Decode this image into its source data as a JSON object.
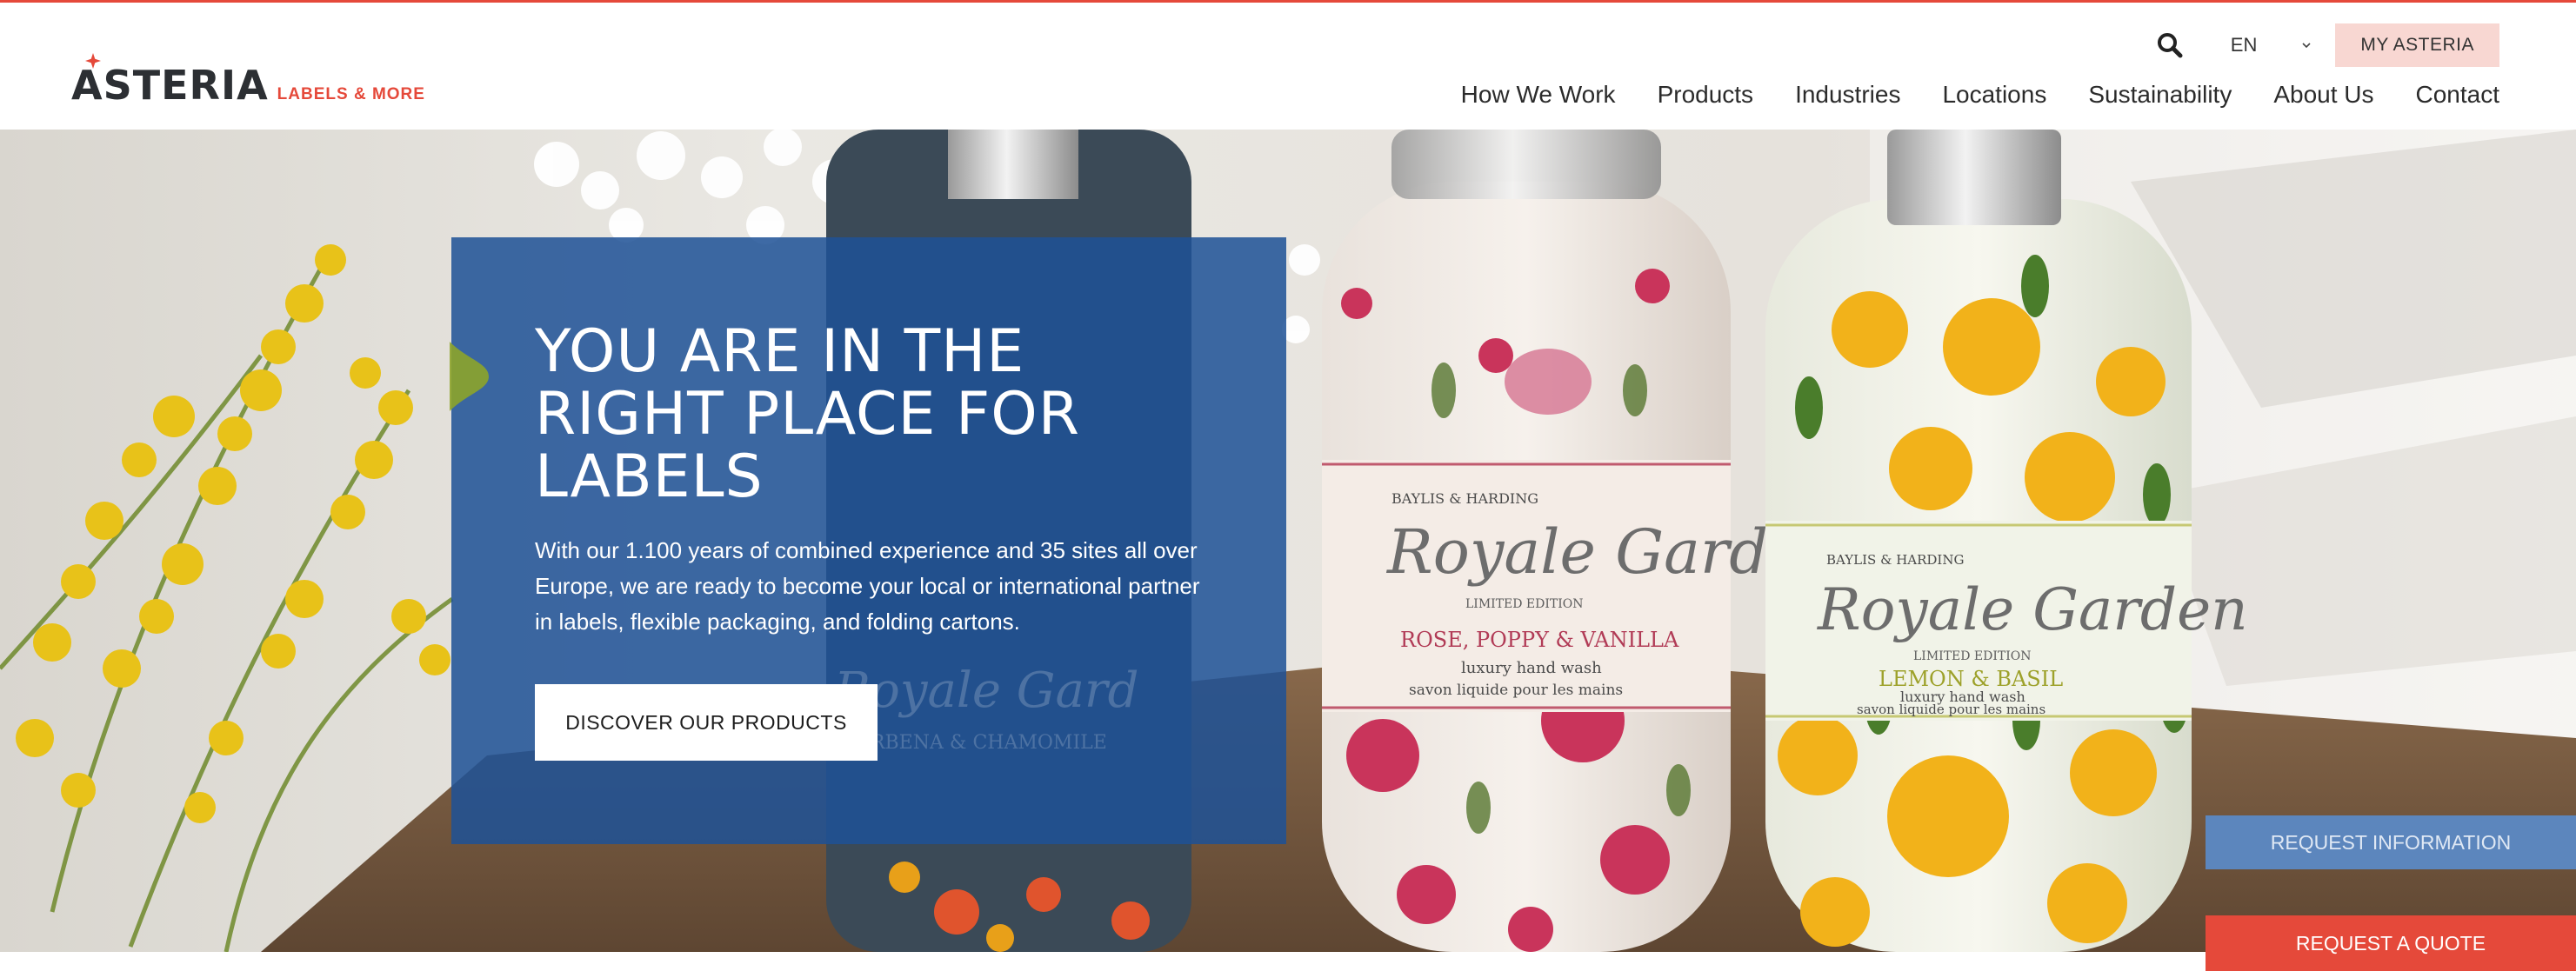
{
  "brand": {
    "name": "ASTERIA",
    "tagline": "LABELS & MORE",
    "accent_color": "#e5493a",
    "primary_blue": "#1e5296"
  },
  "utility": {
    "search_icon": "search-icon",
    "language": "EN",
    "language_chevron_icon": "chevron-down-icon",
    "account_button": "MY ASTERIA"
  },
  "nav": {
    "items": [
      {
        "label": "How We Work"
      },
      {
        "label": "Products"
      },
      {
        "label": "Industries"
      },
      {
        "label": "Locations"
      },
      {
        "label": "Sustainability"
      },
      {
        "label": "About Us"
      },
      {
        "label": "Contact"
      }
    ]
  },
  "hero": {
    "title": "YOU ARE IN THE RIGHT PLACE FOR LABELS",
    "text": "With our 1.100 years of combined experience and 35 sites all over Europe, we are ready to become your local or international partner in labels, flexible packaging, and folding cartons.",
    "cta": "DISCOVER OUR PRODUCTS",
    "products": [
      {
        "brand": "BAYLIS & HARDING",
        "line": "Royale Garden",
        "edition": "LIMITED EDITION",
        "scent": "ROSE, POPPY & VANILLA",
        "desc": "luxury hand wash",
        "desc_fr": "savon liquide pour les mains"
      },
      {
        "brand": "BAYLIS & HARDING",
        "line": "Royale Garden",
        "edition": "LIMITED EDITION",
        "scent": "LEMON & BASIL",
        "desc": "luxury hand wash",
        "desc_fr": "savon liquide pour les mains"
      },
      {
        "line": "Royale Garden",
        "scent": "VERBENA & CHAMOMILE"
      }
    ]
  },
  "floating": {
    "request_information": "REQUEST INFORMATION",
    "request_quote": "REQUEST A QUOTE"
  }
}
